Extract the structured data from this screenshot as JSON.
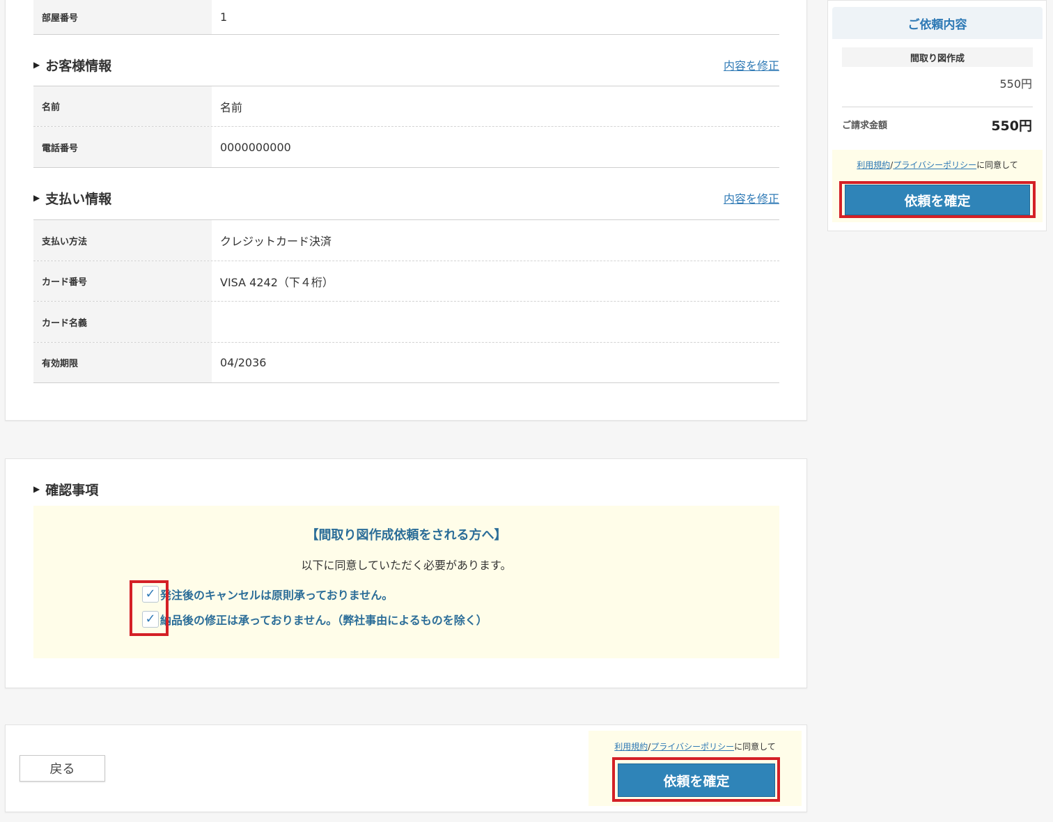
{
  "property": {
    "room_label": "部屋番号",
    "room_value": "1"
  },
  "customer": {
    "title": "お客様情報",
    "edit_link": "内容を修正",
    "name_label": "名前",
    "name_value": "名前",
    "phone_label": "電話番号",
    "phone_value": "0000000000"
  },
  "payment": {
    "title": "支払い情報",
    "edit_link": "内容を修正",
    "method_label": "支払い方法",
    "method_value": "クレジットカード決済",
    "card_label": "カード番号",
    "card_value": "VISA 4242（下４桁）",
    "holder_label": "カード名義",
    "holder_value": "",
    "expiry_label": "有効期限",
    "expiry_value": "04/2036"
  },
  "confirm": {
    "title": "確認事項",
    "notice_heading": "【間取り図作成依頼をされる方へ】",
    "notice_sub": "以下に同意していただく必要があります。",
    "checks": [
      {
        "label": "発注後のキャンセルは原則承っておりません。",
        "checked": true,
        "mark": "✓"
      },
      {
        "label": "納品後の修正は承っておりません。（弊社事由によるものを除く）",
        "checked": true,
        "mark": "✓"
      }
    ]
  },
  "footer": {
    "back_label": "戻る",
    "terms_link": "利用規約",
    "separator": "/",
    "privacy_link": "プライバシーポリシー",
    "agree_suffix": "に同意して",
    "submit_label": "依頼を確定"
  },
  "sidebar": {
    "title": "ご依頼内容",
    "item_name": "間取り図作成",
    "item_price": "550円",
    "total_label": "ご請求金額",
    "total_value": "550円",
    "terms_link": "利用規約",
    "separator": "/",
    "privacy_link": "プライバシーポリシー",
    "agree_suffix": "に同意して",
    "submit_label": "依頼を確定"
  },
  "colors": {
    "accent": "#2f84b8",
    "link": "#2e79b5",
    "highlight_red": "#d42026",
    "notice_bg": "#fffde9"
  }
}
